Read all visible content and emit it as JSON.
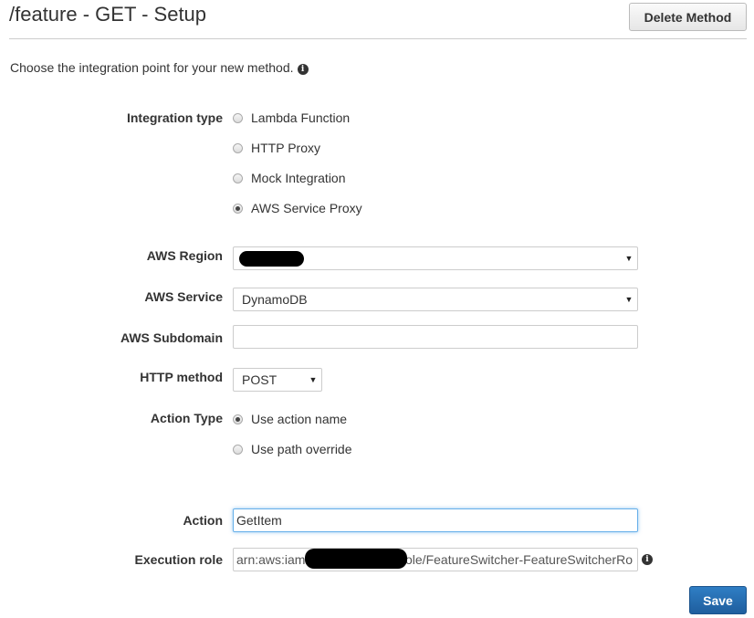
{
  "header": {
    "title": "/feature - GET - Setup",
    "delete_label": "Delete Method"
  },
  "intro": {
    "text": "Choose the integration point for your new method.",
    "info_icon": "info-icon"
  },
  "integration": {
    "label": "Integration type",
    "options": [
      {
        "label": "Lambda Function",
        "selected": false
      },
      {
        "label": "HTTP Proxy",
        "selected": false
      },
      {
        "label": "Mock Integration",
        "selected": false
      },
      {
        "label": "AWS Service Proxy",
        "selected": true
      }
    ]
  },
  "region": {
    "label": "AWS Region",
    "value": ""
  },
  "service": {
    "label": "AWS Service",
    "value": "DynamoDB"
  },
  "subdomain": {
    "label": "AWS Subdomain",
    "value": ""
  },
  "http_method": {
    "label": "HTTP method",
    "value": "POST"
  },
  "action_type": {
    "label": "Action Type",
    "options": [
      {
        "label": "Use action name",
        "selected": true
      },
      {
        "label": "Use path override",
        "selected": false
      }
    ]
  },
  "action": {
    "label": "Action",
    "value": "GetItem"
  },
  "execution_role": {
    "label": "Execution role",
    "value_prefix": "arn:aws:iam",
    "value_suffix": "ole/FeatureSwitcher-FeatureSwitcherRo"
  },
  "save_label": "Save",
  "colors": {
    "primary_button": "#1f66ab",
    "focus_border": "#66afe9",
    "rule": "#cccccc"
  }
}
